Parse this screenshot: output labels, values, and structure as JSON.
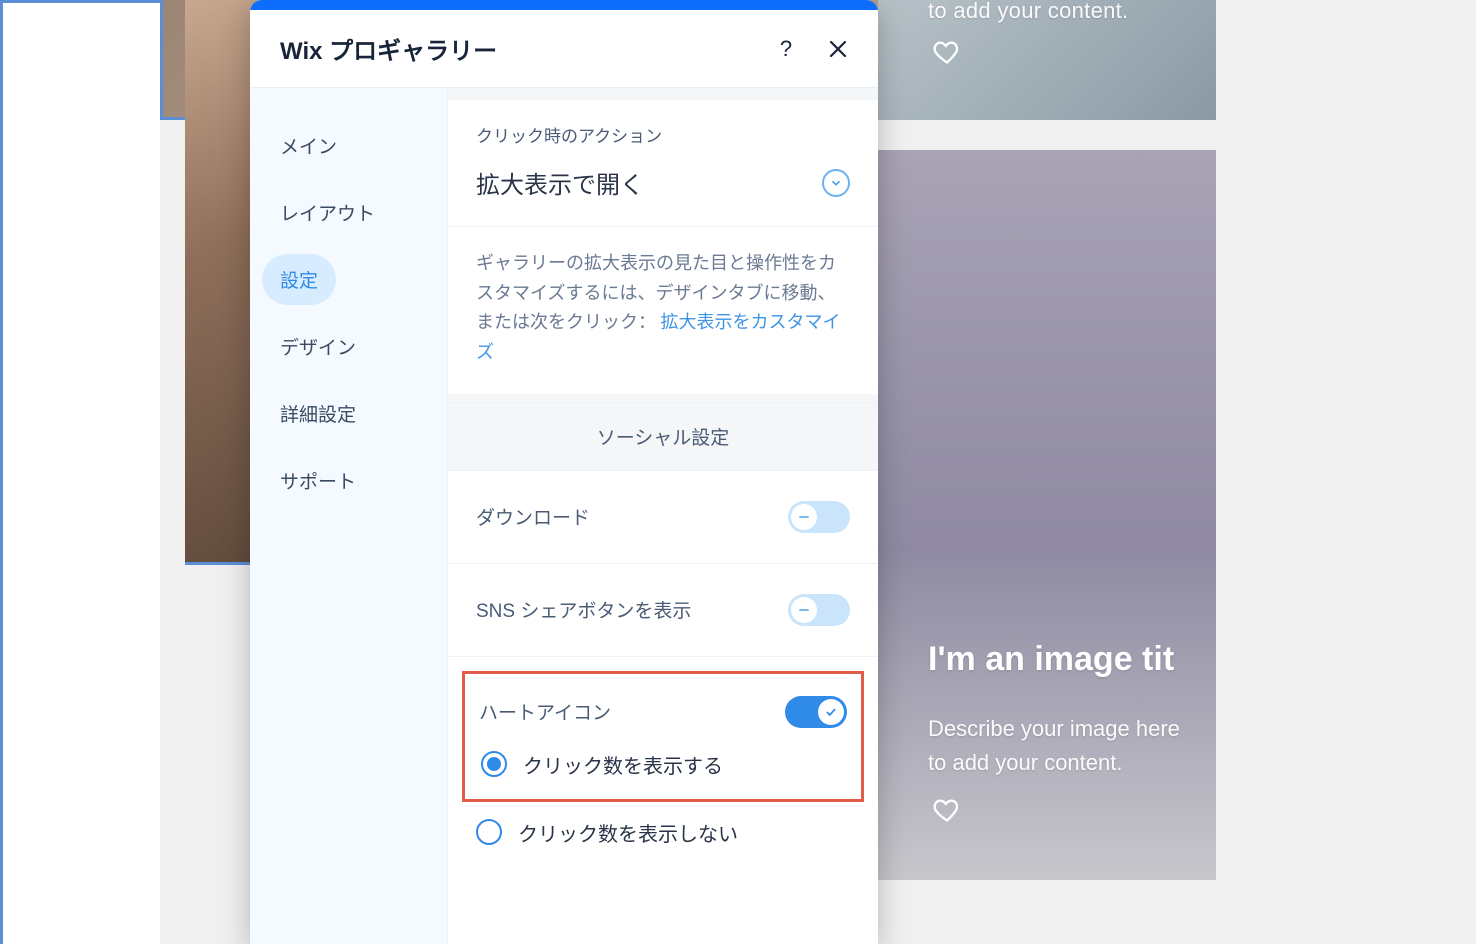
{
  "panel": {
    "title": "Wix プロギャラリー"
  },
  "sidebar": {
    "items": [
      {
        "label": "メイン"
      },
      {
        "label": "レイアウト"
      },
      {
        "label": "設定"
      },
      {
        "label": "デザイン"
      },
      {
        "label": "詳細設定"
      },
      {
        "label": "サポート"
      }
    ],
    "active_index": 2
  },
  "settings": {
    "click_action_label": "クリック時のアクション",
    "click_action_value": "拡大表示で開く",
    "info_text": "ギャラリーの拡大表示の見た目と操作性をカスタマイズするには、デザインタブに移動、または次をクリック：",
    "info_link": "拡大表示をカスタマイズ",
    "social_header": "ソーシャル設定",
    "download_label": "ダウンロード",
    "download_on": false,
    "sns_label": "SNS シェアボタンを表示",
    "sns_on": false,
    "heart_label": "ハートアイコン",
    "heart_on": true,
    "radio_show_clicks": "クリック数を表示する",
    "radio_hide_clicks": "クリック数を表示しない",
    "radio_selected": "show"
  },
  "gallery_preview": {
    "top_content_line": "to add your content.",
    "image_title": "I'm an image tit",
    "desc_line1": "Describe your image here",
    "desc_line2": "to add your content."
  }
}
